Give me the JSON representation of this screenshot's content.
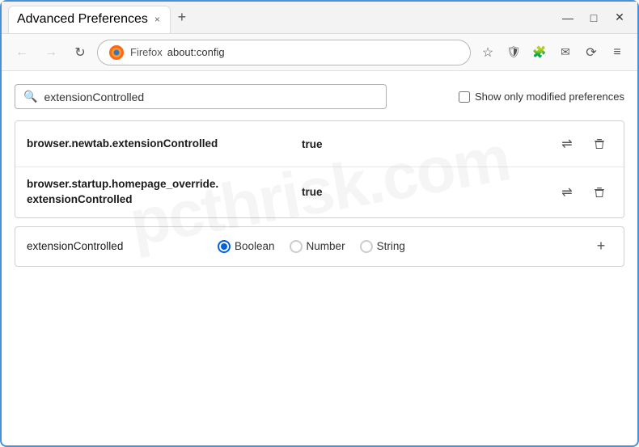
{
  "titlebar": {
    "tab_title": "Advanced Preferences",
    "tab_close": "×",
    "new_tab": "+",
    "minimize": "—",
    "maximize": "□",
    "close": "✕"
  },
  "navbar": {
    "back_label": "←",
    "forward_label": "→",
    "reload_label": "↻",
    "firefox_label": "Firefox",
    "address": "about:config",
    "bookmark_icon": "☆",
    "shield_icon": "🛡",
    "extension_icon": "🧩",
    "share_icon": "✉",
    "sync_icon": "⟳",
    "menu_icon": "≡"
  },
  "search": {
    "placeholder": "extensionControlled",
    "value": "extensionControlled",
    "checkbox_label": "Show only modified preferences"
  },
  "preferences": [
    {
      "name": "browser.newtab.extensionControlled",
      "value": "true"
    },
    {
      "name": "browser.startup.homepage_override.\nextensionControlled",
      "name_line1": "browser.startup.homepage_override.",
      "name_line2": "extensionControlled",
      "value": "true"
    }
  ],
  "add_row": {
    "name": "extensionControlled",
    "radio_options": [
      "Boolean",
      "Number",
      "String"
    ],
    "selected": "Boolean",
    "add_btn": "+"
  },
  "icons": {
    "search": "🔍",
    "swap": "⇌",
    "delete": "🗑",
    "radio_selected": "●",
    "radio_empty": "○"
  }
}
